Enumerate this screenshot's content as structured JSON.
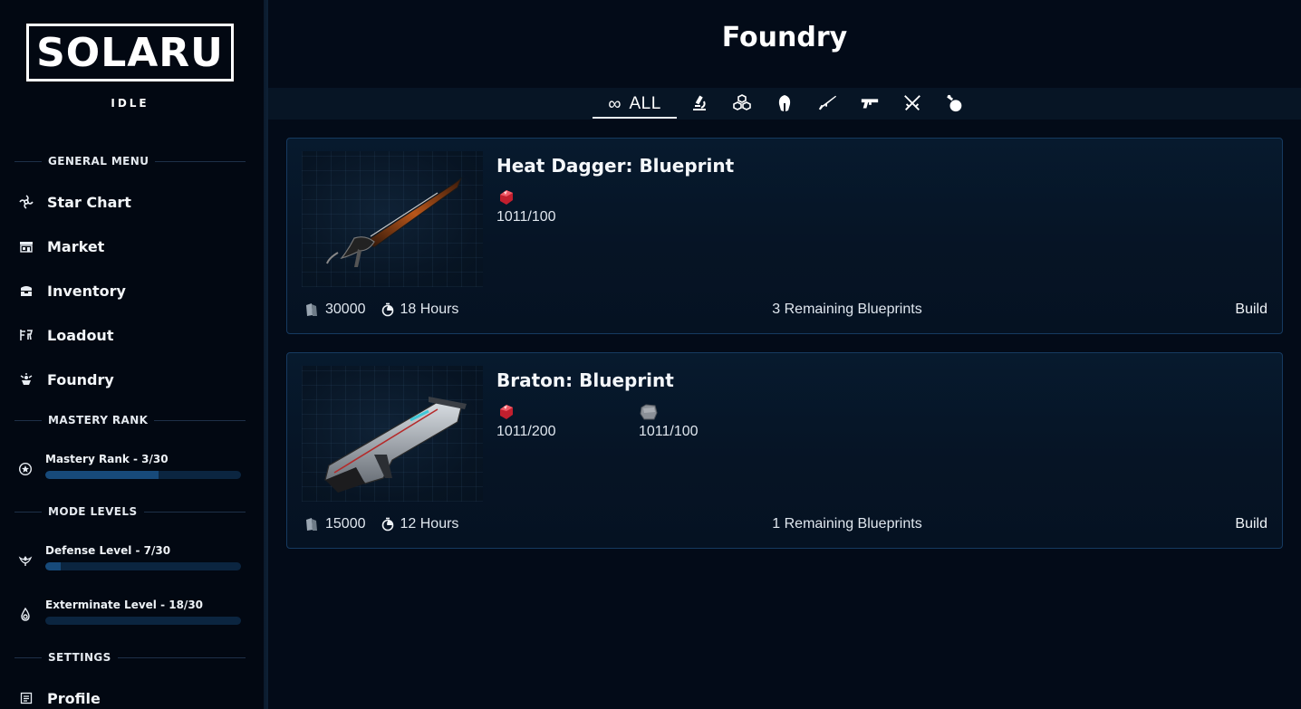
{
  "sidebar": {
    "logo": "SOLARU",
    "logo_sub": "IDLE",
    "general_menu_title": "GENERAL MENU",
    "items": [
      {
        "label": "Star Chart",
        "icon": "star-chart-icon"
      },
      {
        "label": "Market",
        "icon": "market-icon"
      },
      {
        "label": "Inventory",
        "icon": "inventory-icon"
      },
      {
        "label": "Loadout",
        "icon": "loadout-icon"
      },
      {
        "label": "Foundry",
        "icon": "foundry-icon"
      }
    ],
    "mastery_title": "MASTERY RANK",
    "mastery": {
      "label": "Mastery Rank - 3/30",
      "progress": 0.58
    },
    "mode_levels_title": "MODE LEVELS",
    "modes": [
      {
        "label": "Defense Level - 7/30",
        "progress": 0.08,
        "icon": "defense-icon"
      },
      {
        "label": "Exterminate Level - 18/30",
        "progress": 0.0,
        "icon": "exterminate-icon"
      }
    ],
    "settings_title": "SETTINGS",
    "settings_items": [
      {
        "label": "Profile",
        "icon": "profile-icon"
      }
    ]
  },
  "main": {
    "title": "Foundry",
    "filters": {
      "all_label": "ALL",
      "icons": [
        "microscope-icon",
        "cubes-icon",
        "helmet-icon",
        "rifle-icon",
        "pistol-icon",
        "crossed-swords-icon",
        "potion-icon"
      ]
    },
    "cards": [
      {
        "name": "Heat Dagger: Blueprint",
        "resources": [
          {
            "icon": "red-crystal-icon",
            "count": "1011/100"
          }
        ],
        "credits": "30000",
        "time": "18 Hours",
        "remaining": "3 Remaining Blueprints",
        "action": "Build"
      },
      {
        "name": "Braton: Blueprint",
        "resources": [
          {
            "icon": "red-crystal-icon",
            "count": "1011/200"
          },
          {
            "icon": "metal-ore-icon",
            "count": "1011/100"
          }
        ],
        "credits": "15000",
        "time": "12 Hours",
        "remaining": "1 Remaining Blueprints",
        "action": "Build"
      }
    ]
  }
}
